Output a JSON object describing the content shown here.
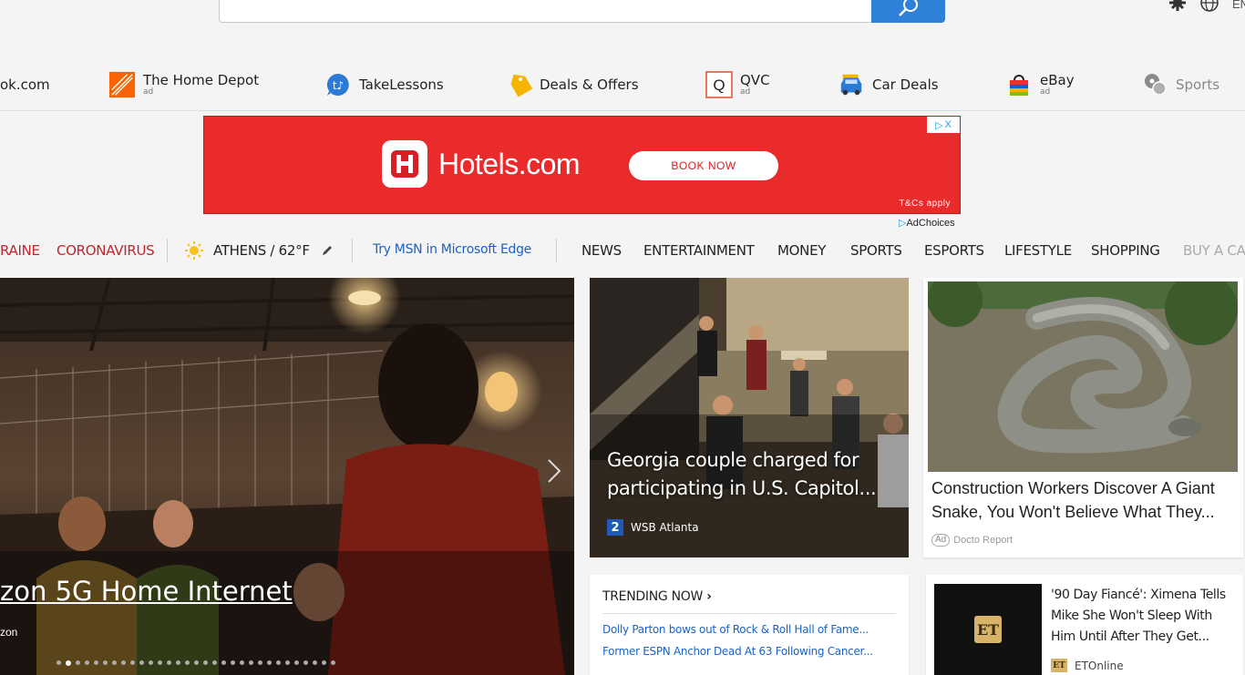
{
  "search": {
    "placeholder": ""
  },
  "header": {
    "language_label": "EN",
    "settings_icon": "gear-icon",
    "globe_icon": "globe-icon"
  },
  "quicklinks": [
    {
      "label": "ok.com",
      "ad": "",
      "icon": "none"
    },
    {
      "label": "The Home Depot",
      "ad": "ad",
      "icon": "home-depot-logo-icon"
    },
    {
      "label": "TakeLessons",
      "ad": "",
      "icon": "takelessons-icon"
    },
    {
      "label": "Deals & Offers",
      "ad": "",
      "icon": "tag-icon"
    },
    {
      "label": "QVC",
      "ad": "ad",
      "icon": "qvc-logo-icon"
    },
    {
      "label": "Car Deals",
      "ad": "",
      "icon": "car-icon"
    },
    {
      "label": "eBay",
      "ad": "ad",
      "icon": "shopping-bag-icon"
    },
    {
      "label": "Sports",
      "ad": "",
      "icon": "sports-ball-icon"
    }
  ],
  "ad_banner": {
    "brand": "Hotels.com",
    "cta": "BOOK NOW",
    "terms": "T&Cs apply",
    "adchoices": "AdChoices",
    "close_label": "X",
    "brand_color": "#ea2b2b"
  },
  "nav": {
    "ukraine": "RAINE",
    "coronavirus": "CORONAVIRUS",
    "weather": "ATHENS / 62°F",
    "edge_promo": "Try MSN in Microsoft Edge",
    "items": [
      "NEWS",
      "ENTERTAINMENT",
      "MONEY",
      "SPORTS",
      "ESPORTS",
      "LIFESTYLE",
      "SHOPPING",
      "BUY A CA"
    ]
  },
  "hero": {
    "title": "zon 5G Home Internet",
    "source": "zon",
    "slide_count": 31,
    "active_slide": 2
  },
  "card_news": {
    "title": "Georgia couple charged for participating in U.S. Capitol...",
    "source": "WSB Atlanta",
    "source_logo": "2"
  },
  "card_ad": {
    "title": "Construction Workers Discover A Giant Snake, You Won't Believe What They...",
    "ad_label": "Ad",
    "source": "Docto Report"
  },
  "trending": {
    "header": "TRENDING NOW",
    "items": [
      "Dolly Parton bows out of Rock & Roll Hall of Fame...",
      "Former ESPN Anchor Dead At 63 Following Cancer..."
    ]
  },
  "card_et": {
    "title": "'90 Day Fiancé': Ximena Tells Mike She Won't Sleep With Him Until After They Get...",
    "source": "ETOnline",
    "logo": "ET"
  }
}
